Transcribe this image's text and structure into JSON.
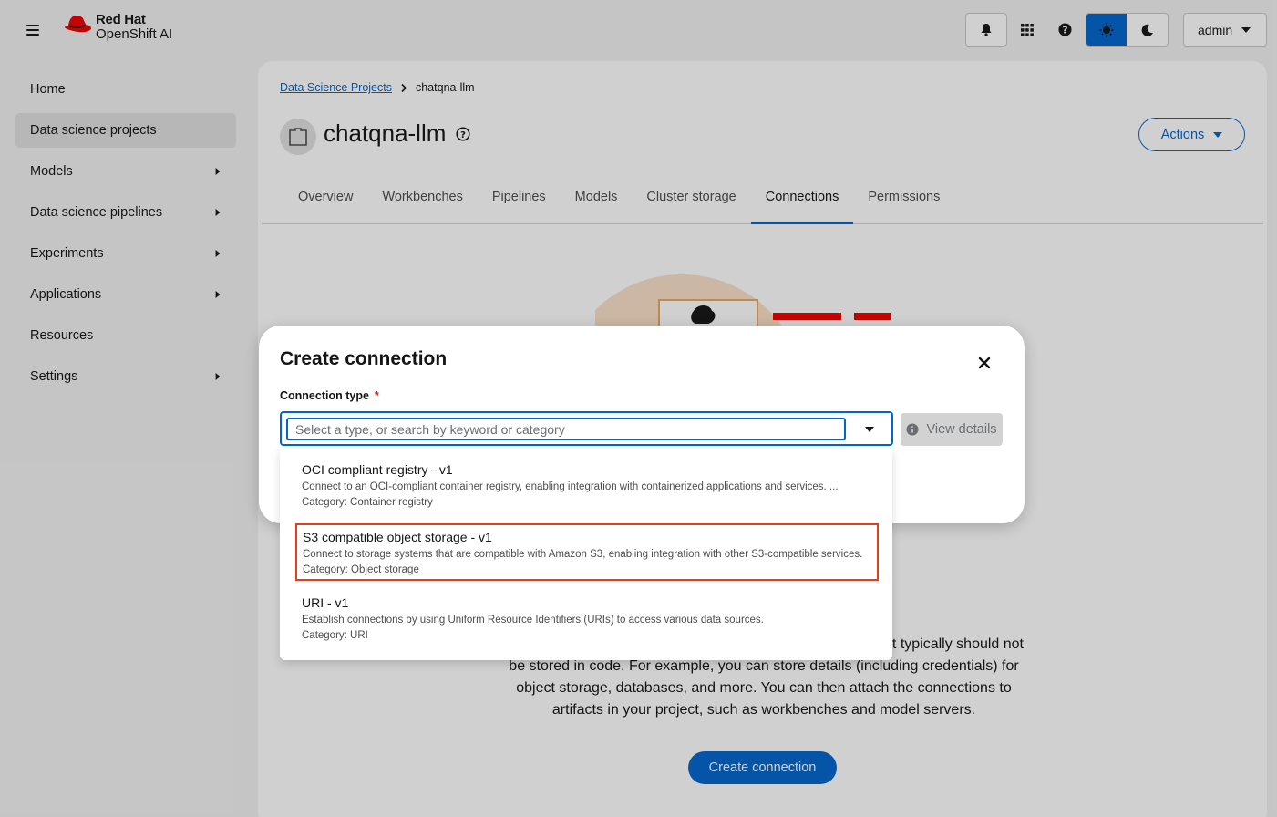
{
  "masthead": {
    "brand_line1": "Red Hat",
    "brand_line2": "OpenShift AI",
    "user_label": "admin"
  },
  "sidebar": {
    "items": [
      {
        "label": "Home",
        "expandable": false
      },
      {
        "label": "Data science projects",
        "expandable": false,
        "active": true
      },
      {
        "label": "Models",
        "expandable": true
      },
      {
        "label": "Data science pipelines",
        "expandable": true
      },
      {
        "label": "Experiments",
        "expandable": true
      },
      {
        "label": "Applications",
        "expandable": true
      },
      {
        "label": "Resources",
        "expandable": false
      },
      {
        "label": "Settings",
        "expandable": true
      }
    ]
  },
  "main": {
    "breadcrumb": {
      "root": "Data Science Projects",
      "current": "chatqna-llm"
    },
    "project_title": "chatqna-llm",
    "actions_label": "Actions",
    "tabs": [
      "Overview",
      "Workbenches",
      "Pipelines",
      "Models",
      "Cluster storage",
      "Connections",
      "Permissions"
    ],
    "active_tab": "Connections",
    "description": {
      "line1": "t typically should not",
      "line2": "be stored in code. For example, you can store details (including credentials) for",
      "line3": "object storage, databases, and more. You can then attach the connections to",
      "line4": "artifacts in your project, such as workbenches and model servers."
    },
    "create_button": "Create connection"
  },
  "modal": {
    "title": "Create connection",
    "field_label": "Connection type",
    "required_mark": "*",
    "select_placeholder": "Select a type, or search by keyword or category",
    "view_details": "View details"
  },
  "dropdown": {
    "options": [
      {
        "title": "OCI compliant registry - v1",
        "description": "Connect to an OCI-compliant container registry, enabling integration with containerized applications and services. ...",
        "category": "Category: Container registry"
      },
      {
        "title": "S3 compatible object storage - v1",
        "description": "Connect to storage systems that are compatible with Amazon S3, enabling integration with other S3-compatible services.",
        "category": "Category: Object storage",
        "highlighted": true
      },
      {
        "title": "URI - v1",
        "description": "Establish connections by using Uniform Resource Identifiers (URIs) to access various data sources.",
        "category": "Category: URI"
      }
    ]
  },
  "colors": {
    "accent": "#0066cc",
    "highlight_border": "#e0401a",
    "brand_red": "#ee0000"
  }
}
